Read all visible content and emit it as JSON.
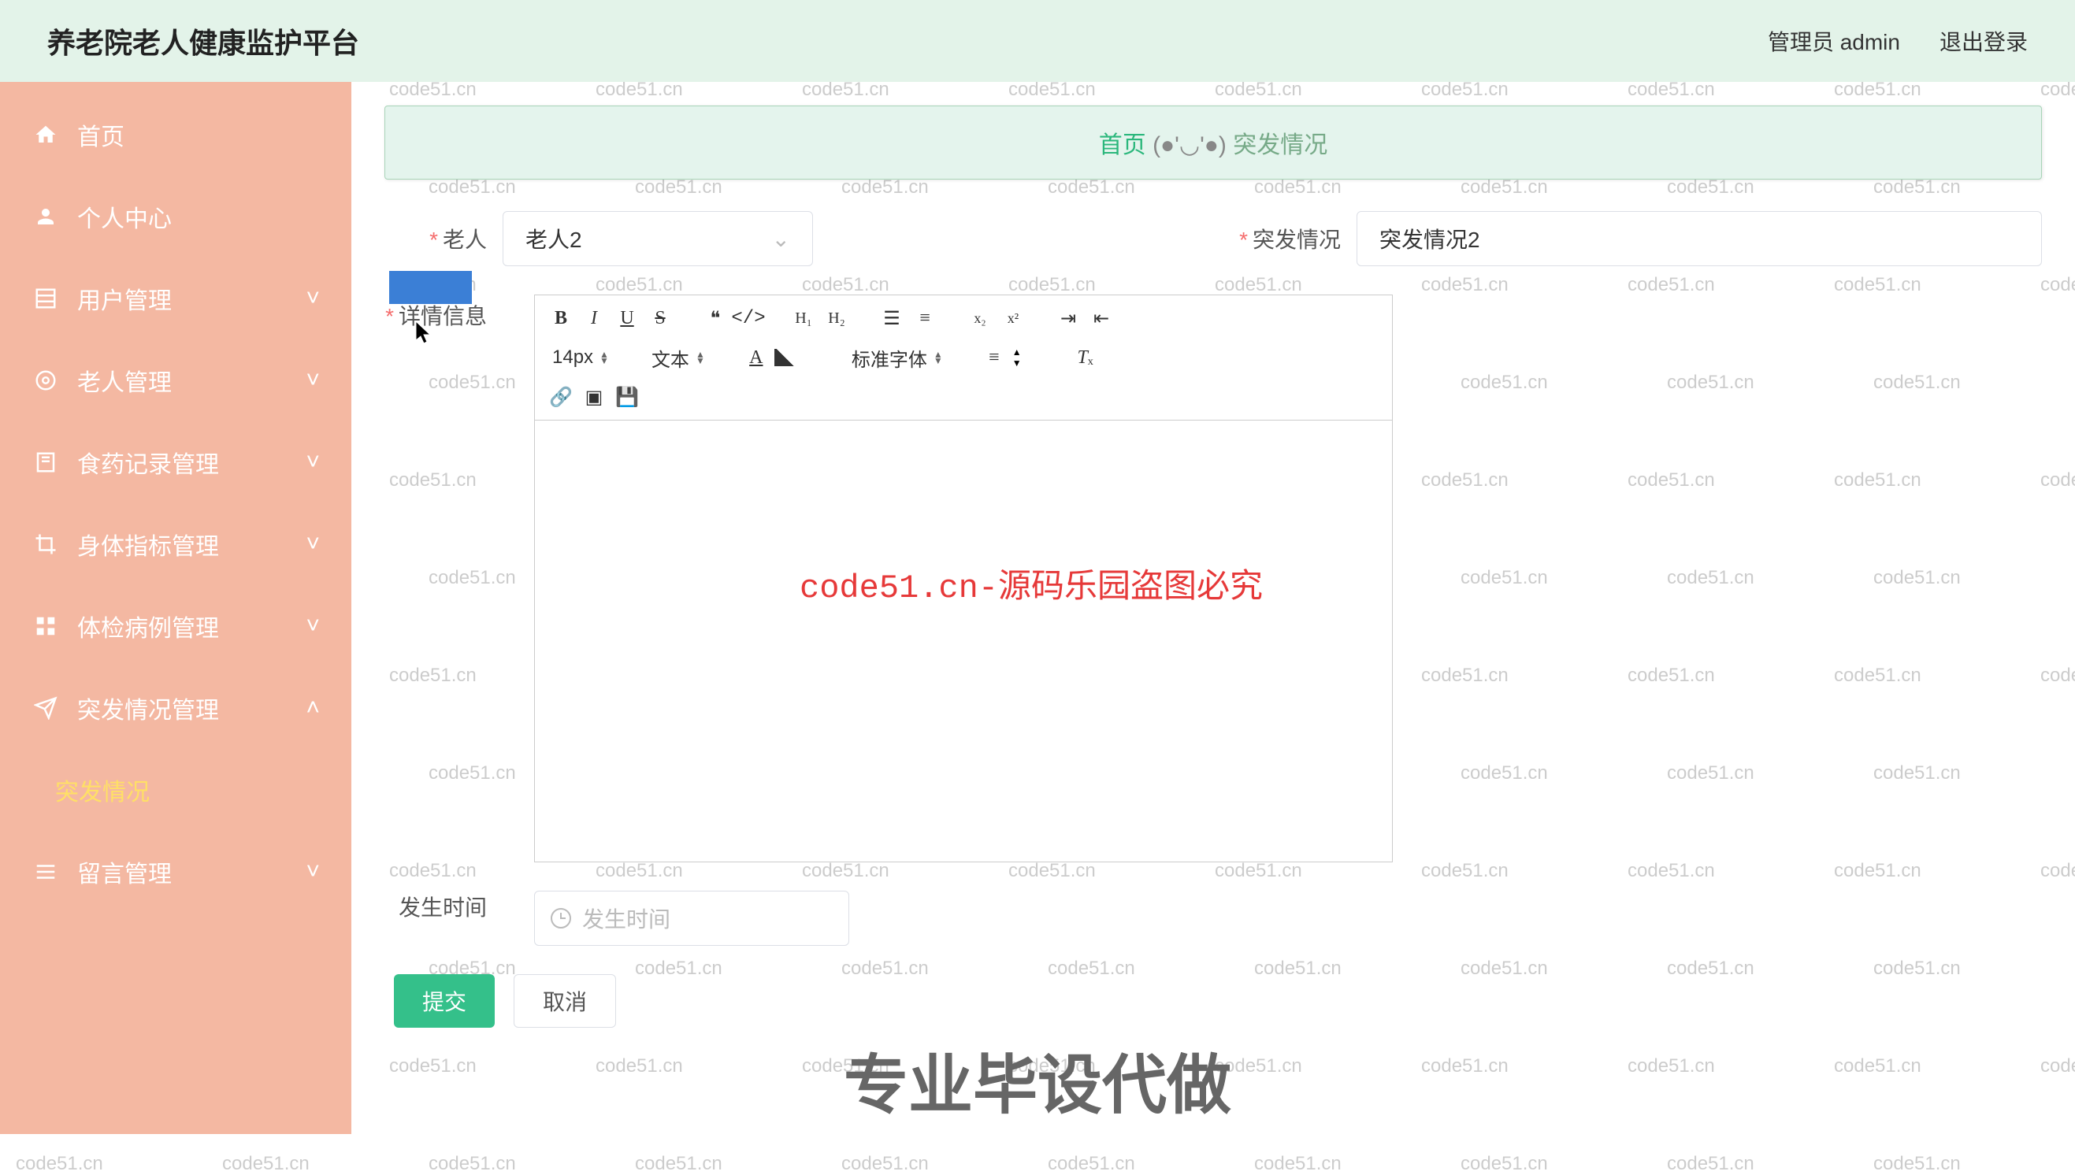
{
  "header": {
    "title": "养老院老人健康监护平台",
    "user_label": "管理员 admin",
    "logout": "退出登录"
  },
  "sidebar": {
    "items": [
      {
        "label": "首页",
        "icon": "home"
      },
      {
        "label": "个人中心",
        "icon": "user"
      },
      {
        "label": "用户管理",
        "icon": "grid",
        "expandable": true
      },
      {
        "label": "老人管理",
        "icon": "gear",
        "expandable": true
      },
      {
        "label": "食药记录管理",
        "icon": "book",
        "expandable": true
      },
      {
        "label": "身体指标管理",
        "icon": "crop",
        "expandable": true
      },
      {
        "label": "体检病例管理",
        "icon": "grid4",
        "expandable": true
      },
      {
        "label": "突发情况管理",
        "icon": "send",
        "expandable": true,
        "expanded": true
      },
      {
        "label": "突发情况",
        "sub": true,
        "selected": true
      },
      {
        "label": "留言管理",
        "icon": "menu",
        "expandable": true
      }
    ]
  },
  "breadcrumb": {
    "home": "首页",
    "face": "(●'◡'●)",
    "current": "突发情况"
  },
  "form": {
    "elder_label": "老人",
    "elder_value": "老人2",
    "situation_label": "突发情况",
    "situation_value": "突发情况2",
    "detail_label": "详情信息",
    "time_label": "发生时间",
    "time_placeholder": "发生时间",
    "submit": "提交",
    "cancel": "取消"
  },
  "toolbar": {
    "fontsize": "14px",
    "texttype": "文本",
    "fontfamily": "标准字体"
  },
  "watermark": {
    "text": "code51.cn",
    "center": "code51.cn-源码乐园盗图必究",
    "caption": "专业毕设代做"
  }
}
